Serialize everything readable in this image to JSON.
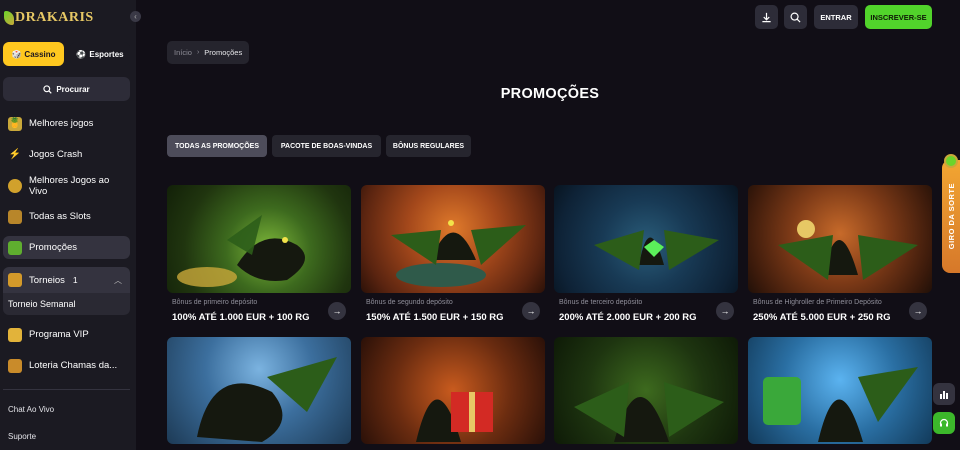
{
  "brand": {
    "logo_text": "DRAKARIS"
  },
  "sidebar": {
    "tabs": [
      {
        "label": "Cassino",
        "icon": "casino-chip-icon"
      },
      {
        "label": "Esportes",
        "icon": "soccer-ball-icon"
      }
    ],
    "search_label": "Procurar",
    "items": [
      {
        "label": "Melhores jogos",
        "icon": "pineapple-icon"
      },
      {
        "label": "Jogos Crash",
        "icon": "lightning-icon"
      },
      {
        "label": "Melhores Jogos ao Vivo",
        "icon": "coins-icon"
      },
      {
        "label": "Todas as Slots",
        "icon": "slot-dice-icon"
      },
      {
        "label": "Promoções",
        "icon": "gift-icon"
      },
      {
        "label": "Torneios",
        "icon": "trophy-icon",
        "count": "1"
      },
      {
        "label": "Programa VIP",
        "icon": "crown-icon"
      },
      {
        "label": "Loteria Chamas da...",
        "icon": "lottery-icon"
      }
    ],
    "sub_item": "Torneio Semanal",
    "links": [
      "Chat Ao Vivo",
      "Suporte"
    ]
  },
  "header": {
    "login_label": "ENTRAR",
    "signup_label": "INSCREVER-SE"
  },
  "breadcrumb": {
    "home": "Início",
    "current": "Promoções"
  },
  "page": {
    "title": "PROMOÇÕES",
    "filters": [
      "TODAS AS PROMOÇÕES",
      "PACOTE DE BOAS-VINDAS",
      "BÔNUS REGULARES"
    ]
  },
  "promotions": [
    {
      "label": "Bônus de primeiro depósito",
      "title": "100% ATÉ 1.000 EUR + 100 RG"
    },
    {
      "label": "Bônus de segundo depósito",
      "title": "150% ATÉ 1.500 EUR + 150 RG"
    },
    {
      "label": "Bônus de terceiro depósito",
      "title": "200% ATÉ 2.000 EUR + 200 RG"
    },
    {
      "label": "Bônus de Highroller de Primeiro Depósito",
      "title": "250% ATÉ 5.000 EUR + 250 RG"
    }
  ],
  "side_tab": {
    "label": "GIRO DA SORTE"
  },
  "colors": {
    "accent_yellow": "#ffc81f",
    "accent_green": "#51d32b",
    "bg": "#110e16",
    "sidebar_bg": "#1b1a22"
  }
}
